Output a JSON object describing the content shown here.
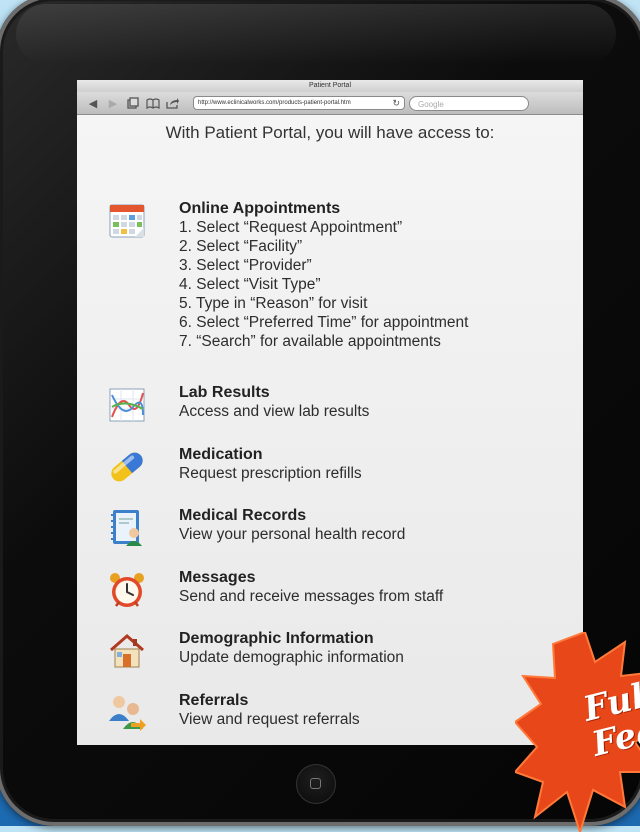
{
  "browser": {
    "window_title": "Patient Portal",
    "url": "http://www.eclinicalworks.com/products-patient-portal.htm",
    "search_placeholder": "Google"
  },
  "page": {
    "intro": "With Patient Portal, you will have access to:",
    "features": [
      {
        "title": "Online Appointments",
        "icon": "calendar-icon",
        "steps": [
          "1. Select “Request Appointment”",
          "2. Select “Facility”",
          "3. Select “Provider”",
          "4. Select “Visit Type”",
          "5. Type in “Reason” for visit",
          "6. Select “Preferred Time” for appointment",
          "7. “Search” for available appointments"
        ]
      },
      {
        "title": "Lab Results",
        "description": "Access and view lab results",
        "icon": "chart-icon"
      },
      {
        "title": "Medication",
        "description": "Request prescription refills",
        "icon": "pill-icon"
      },
      {
        "title": "Medical Records",
        "description": "View your personal health record",
        "icon": "records-book-icon"
      },
      {
        "title": "Messages",
        "description": "Send and receive messages from staff",
        "icon": "alarm-clock-icon"
      },
      {
        "title": "Demographic Information",
        "description": "Update demographic information",
        "icon": "house-icon"
      },
      {
        "title": "Referrals",
        "description": "View and request referrals",
        "icon": "referral-users-icon"
      }
    ]
  },
  "badge": {
    "line1": "Full",
    "line2": "Feat"
  },
  "colors": {
    "background": "#2f8fd0",
    "badge": "#e8471a",
    "bezel": "#0c0c0c"
  }
}
